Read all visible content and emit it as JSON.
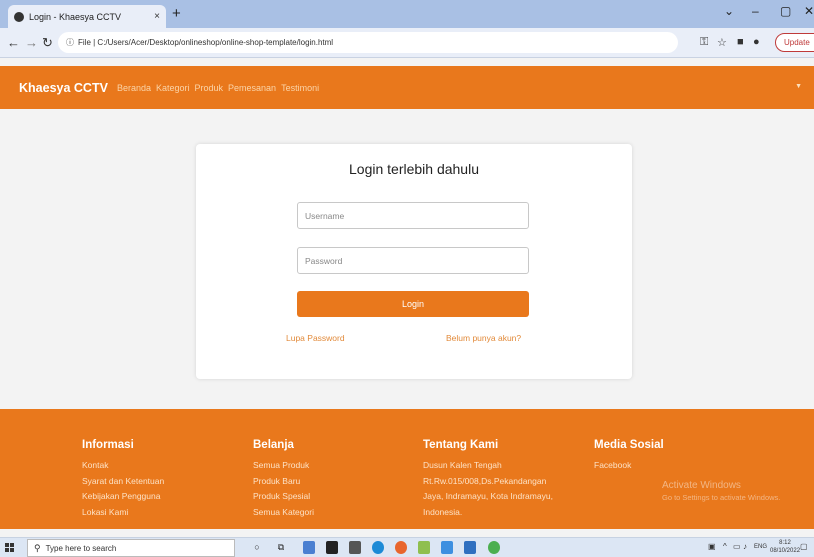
{
  "browser": {
    "tab_title": "Login - Khaesya CCTV",
    "tab_close": "×",
    "new_tab": "+",
    "address": "File | C:/Users/Acer/Desktop/onlineshop/online-shop-template/login.html",
    "update_label": "Update",
    "win_min": "–",
    "win_max": "▢",
    "win_close": "✕",
    "chevron": "⌄"
  },
  "site_nav": {
    "brand": "Khaesya CCTV",
    "links": [
      "Beranda",
      "Kategori",
      "Produk",
      "Pemesanan",
      "Testimoni"
    ]
  },
  "login": {
    "title": "Login terlebih dahulu",
    "username_placeholder": "Username",
    "password_placeholder": "Password",
    "button": "Login",
    "forgot": "Lupa Password",
    "register": "Belum punya akun?"
  },
  "footer": {
    "columns": [
      {
        "title": "Informasi",
        "items": [
          "Kontak",
          "Syarat dan Ketentuan",
          "Kebijakan Pengguna",
          "Lokasi Kami"
        ]
      },
      {
        "title": "Belanja",
        "items": [
          "Semua Produk",
          "Produk Baru",
          "Produk Spesial",
          "Semua Kategori"
        ]
      },
      {
        "title": "Tentang Kami",
        "items": [
          "Dusun Kalen Tengah",
          "Rt.Rw.015/008,Ds.Pekandangan",
          "Jaya, Indramayu, Kota Indramayu,",
          "Indonesia."
        ]
      },
      {
        "title": "Media Sosial",
        "items": [
          "Facebook"
        ]
      }
    ],
    "activate_title": "Activate Windows",
    "activate_sub": "Go to Settings to activate Windows."
  },
  "taskbar": {
    "search_placeholder": "Type here to search",
    "lang": "ENG",
    "time": "8:12",
    "date": "08/10/2022"
  },
  "colors": {
    "brand_orange": "#e9781c",
    "tabbar_blue": "#a9c0e4"
  }
}
